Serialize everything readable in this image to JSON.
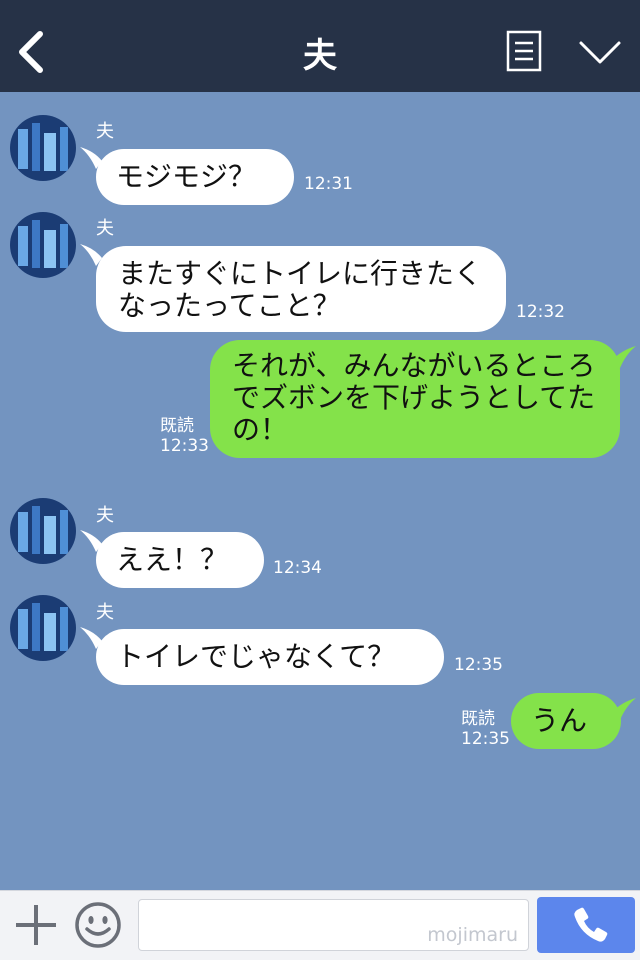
{
  "header": {
    "title": "夫",
    "back_icon": "chevron-left-icon",
    "menu_icon": "list-icon",
    "expand_icon": "chevron-down-icon"
  },
  "messages": [
    {
      "side": "in",
      "sender": "夫",
      "text": "モジモジ？",
      "time": "12:31"
    },
    {
      "side": "in",
      "sender": "夫",
      "text": "またすぐにトイレに行きたくなったってこと？",
      "time": "12:32"
    },
    {
      "side": "out",
      "text": "それが、みんながいるところでズボンを下げようとしてたの！",
      "read": "既読",
      "time": "12:33"
    },
    {
      "side": "in",
      "sender": "夫",
      "text": "ええ！？",
      "time": "12:34"
    },
    {
      "side": "in",
      "sender": "夫",
      "text": "トイレでじゃなくて？",
      "time": "12:35"
    },
    {
      "side": "out",
      "text": "うん",
      "read": "既読",
      "time": "12:35"
    }
  ],
  "footer": {
    "plus_icon": "plus-icon",
    "emoji_icon": "smile-icon",
    "input_value": "",
    "watermark": "mojimaru",
    "call_icon": "phone-icon"
  },
  "colors": {
    "header_bg": "#263247",
    "chat_bg": "#7394c0",
    "bubble_in": "#ffffff",
    "bubble_out": "#84e24a",
    "call_button": "#5c86ec"
  }
}
